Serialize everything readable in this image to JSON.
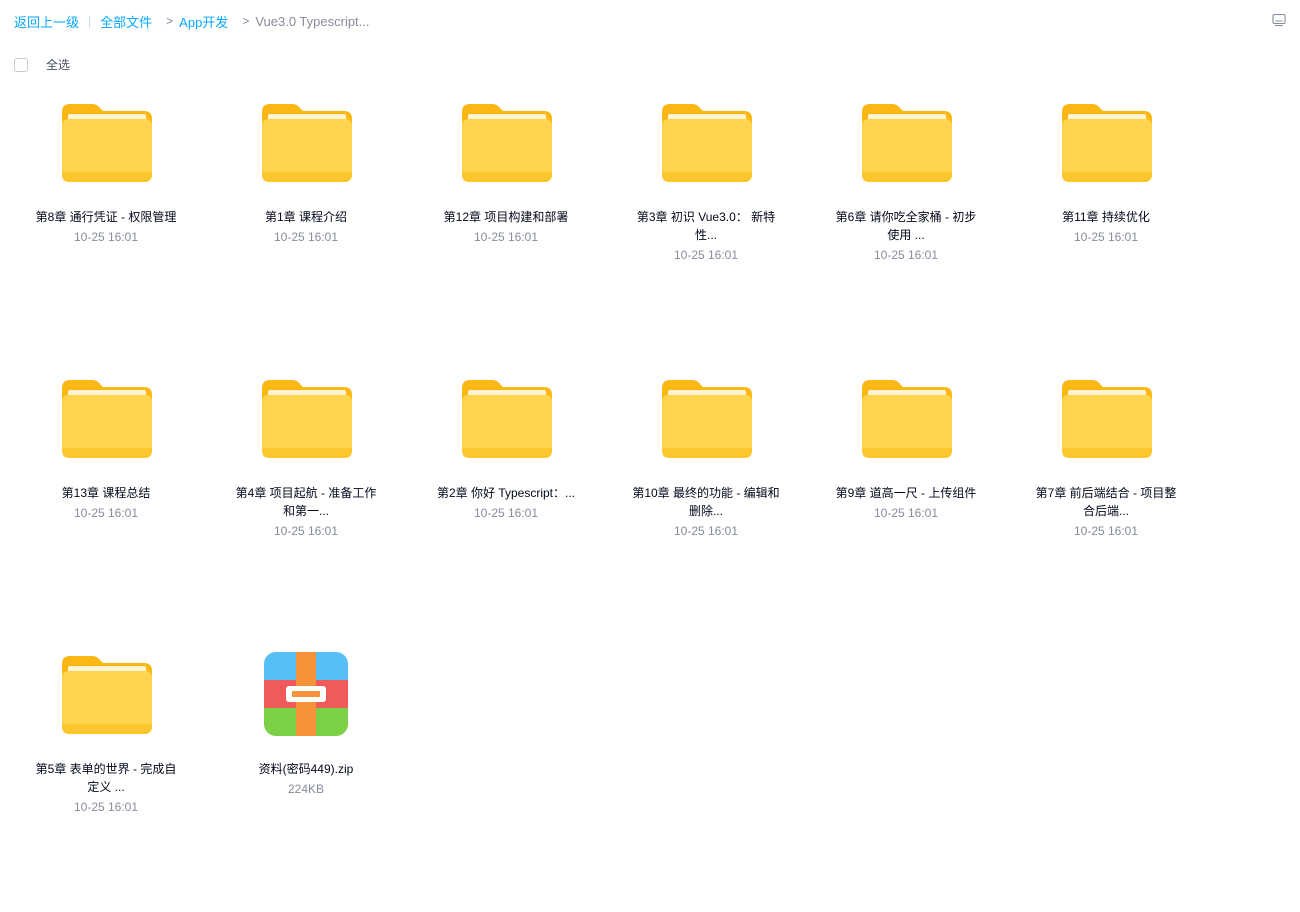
{
  "breadcrumb": {
    "back": "返回上一级",
    "divider": "|",
    "arrow": ">",
    "all_files": "全部文件",
    "app_dev": "App开发",
    "current": "Vue3.0 Typescript..."
  },
  "toolbar": {
    "select_all": "全选",
    "view_icon": "list-view-icon"
  },
  "colors": {
    "link": "#06a7ff",
    "muted": "#878c9c",
    "folder_back": "#fbb814",
    "folder_front": "#ffd44f"
  },
  "items": [
    {
      "type": "folder",
      "icon": "folder-icon",
      "name": "第8章 通行凭证 - 权限管理",
      "meta": "10-25 16:01"
    },
    {
      "type": "folder",
      "icon": "folder-icon",
      "name": "第1章 课程介绍",
      "meta": "10-25 16:01"
    },
    {
      "type": "folder",
      "icon": "folder-icon",
      "name": "第12章 项目构建和部署",
      "meta": "10-25 16:01"
    },
    {
      "type": "folder",
      "icon": "folder-icon",
      "name": "第3章 初识 Vue3.0： 新特性...",
      "meta": "10-25 16:01"
    },
    {
      "type": "folder",
      "icon": "folder-icon",
      "name": "第6章 请你吃全家桶 - 初步使用 ...",
      "meta": "10-25 16:01"
    },
    {
      "type": "folder",
      "icon": "folder-icon",
      "name": "第11章 持续优化",
      "meta": "10-25 16:01"
    },
    {
      "type": "folder",
      "icon": "folder-icon",
      "name": "第13章 课程总结",
      "meta": "10-25 16:01"
    },
    {
      "type": "folder",
      "icon": "folder-icon",
      "name": "第4章 项目起航 - 准备工作和第一...",
      "meta": "10-25 16:01"
    },
    {
      "type": "folder",
      "icon": "folder-icon",
      "name": "第2章 你好 Typescript：...",
      "meta": "10-25 16:01"
    },
    {
      "type": "folder",
      "icon": "folder-icon",
      "name": "第10章 最终的功能 - 编辑和删除...",
      "meta": "10-25 16:01"
    },
    {
      "type": "folder",
      "icon": "folder-icon",
      "name": "第9章 道高一尺 - 上传组件",
      "meta": "10-25 16:01"
    },
    {
      "type": "folder",
      "icon": "folder-icon",
      "name": "第7章 前后端结合 - 项目整合后端...",
      "meta": "10-25 16:01"
    },
    {
      "type": "folder",
      "icon": "folder-icon",
      "name": "第5章 表单的世界 - 完成自定义 ...",
      "meta": "10-25 16:01"
    },
    {
      "type": "archive",
      "icon": "zip-archive-icon",
      "name": "资料(密码449).zip",
      "meta": "224KB"
    }
  ]
}
